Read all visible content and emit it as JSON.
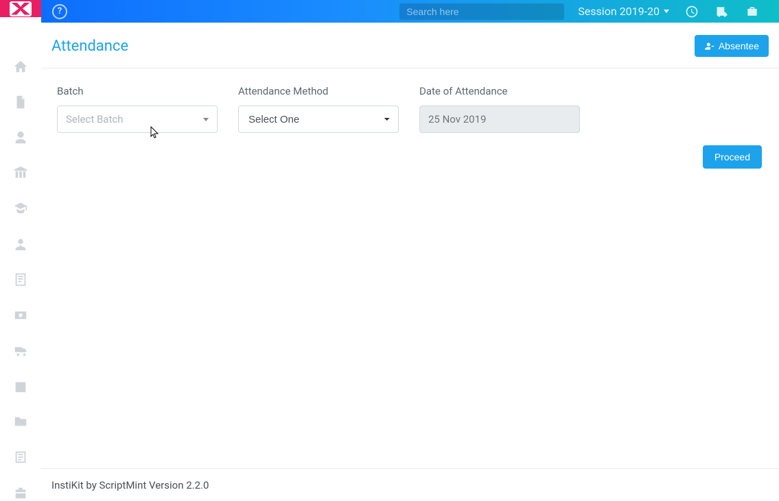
{
  "header": {
    "search_placeholder": "Search here",
    "session_label": "Session 2019-20"
  },
  "sidebar": {
    "items": [
      {
        "name": "home"
      },
      {
        "name": "document"
      },
      {
        "name": "user"
      },
      {
        "name": "institute"
      },
      {
        "name": "academics"
      },
      {
        "name": "employee"
      },
      {
        "name": "notes"
      },
      {
        "name": "finance"
      },
      {
        "name": "transport"
      },
      {
        "name": "calendar"
      },
      {
        "name": "folder"
      },
      {
        "name": "library"
      },
      {
        "name": "inventory"
      }
    ]
  },
  "page": {
    "title": "Attendance",
    "absentee_label": "Absentee",
    "proceed_label": "Proceed"
  },
  "form": {
    "batch": {
      "label": "Batch",
      "placeholder": "Select Batch"
    },
    "method": {
      "label": "Attendance Method",
      "selected": "Select One"
    },
    "date": {
      "label": "Date of Attendance",
      "value": "25 Nov 2019"
    }
  },
  "footer": {
    "text": "InstiKit by ScriptMint Version 2.2.0"
  }
}
